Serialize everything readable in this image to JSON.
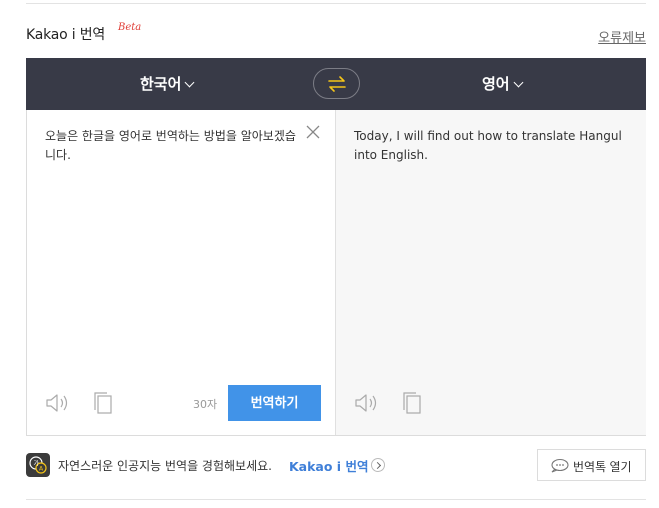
{
  "header": {
    "brand": "Kakao i 번역",
    "beta": "Beta",
    "report_link": "오류제보"
  },
  "languages": {
    "source": "한국어",
    "target": "영어",
    "swap_icon": "swap-arrows-icon",
    "swap_color": "#f5c518"
  },
  "source_panel": {
    "text": "오늘은 한글을 영어로 번역하는 방법을 알아보겠습니다.",
    "char_count": "30자",
    "translate_button": "번역하기",
    "icons": [
      "close-icon",
      "speaker-icon",
      "copy-icon"
    ]
  },
  "target_panel": {
    "text": "Today, I will find out how to translate Hangul into English.",
    "icons": [
      "speaker-icon",
      "copy-icon"
    ]
  },
  "footer": {
    "promo_text": "자연스러운 인공지능 번역을 경험해보세요.",
    "promo_link": "Kakao i 번역",
    "open_chat_label": "번역톡 열기"
  },
  "colors": {
    "lang_bar": "#383a47",
    "accent_button": "#4193e8",
    "link": "#3f7fd8",
    "beta": "#e0403a"
  }
}
